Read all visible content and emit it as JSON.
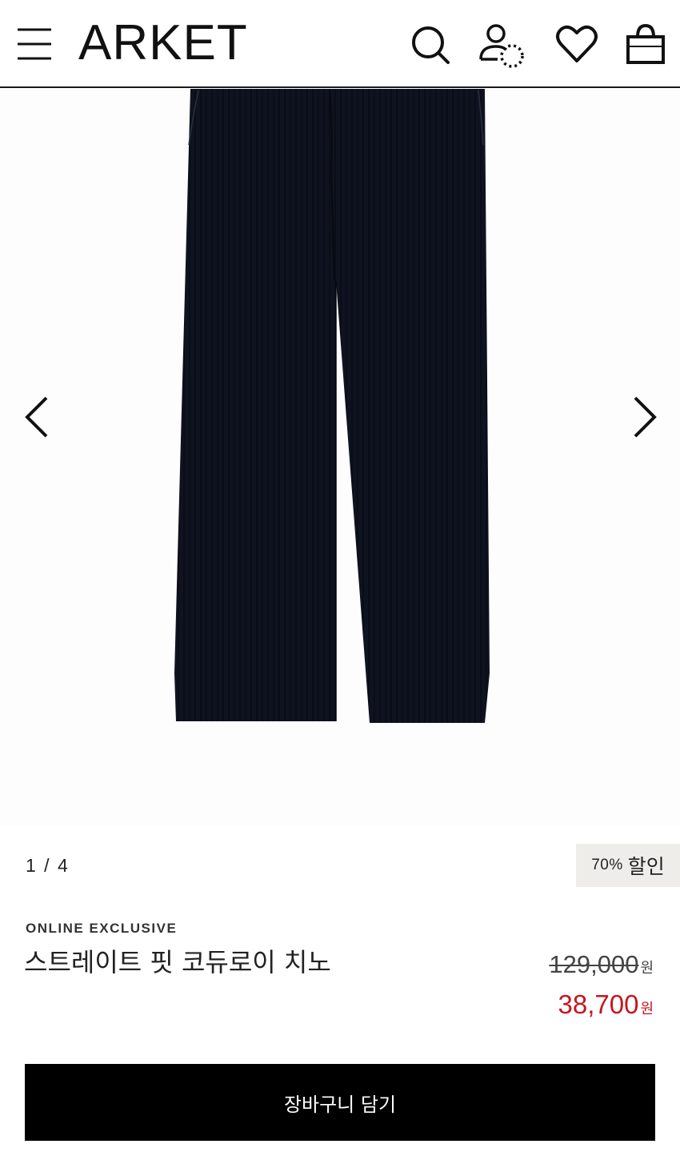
{
  "header": {
    "logo": "ARKET",
    "icons": [
      "menu-icon",
      "search-icon",
      "account-icon",
      "wishlist-heart-icon",
      "shopping-bag-icon"
    ]
  },
  "gallery": {
    "counter": "1 / 4",
    "prev_icon": "chevron-left-icon",
    "next_icon": "chevron-right-icon"
  },
  "badge": {
    "percent": "70%",
    "word": "할인"
  },
  "product": {
    "tag": "ONLINE EXCLUSIVE",
    "name": "스트레이트 핏 코듀로이 치노",
    "original_price": "129,000",
    "sale_price": "38,700",
    "currency": "원"
  },
  "actions": {
    "add_to_cart": "장바구니 담기"
  },
  "colors": {
    "sale": "#c4171f",
    "badge_bg": "#efedea",
    "button_bg": "#000000",
    "product_navy": "#0f1320"
  }
}
